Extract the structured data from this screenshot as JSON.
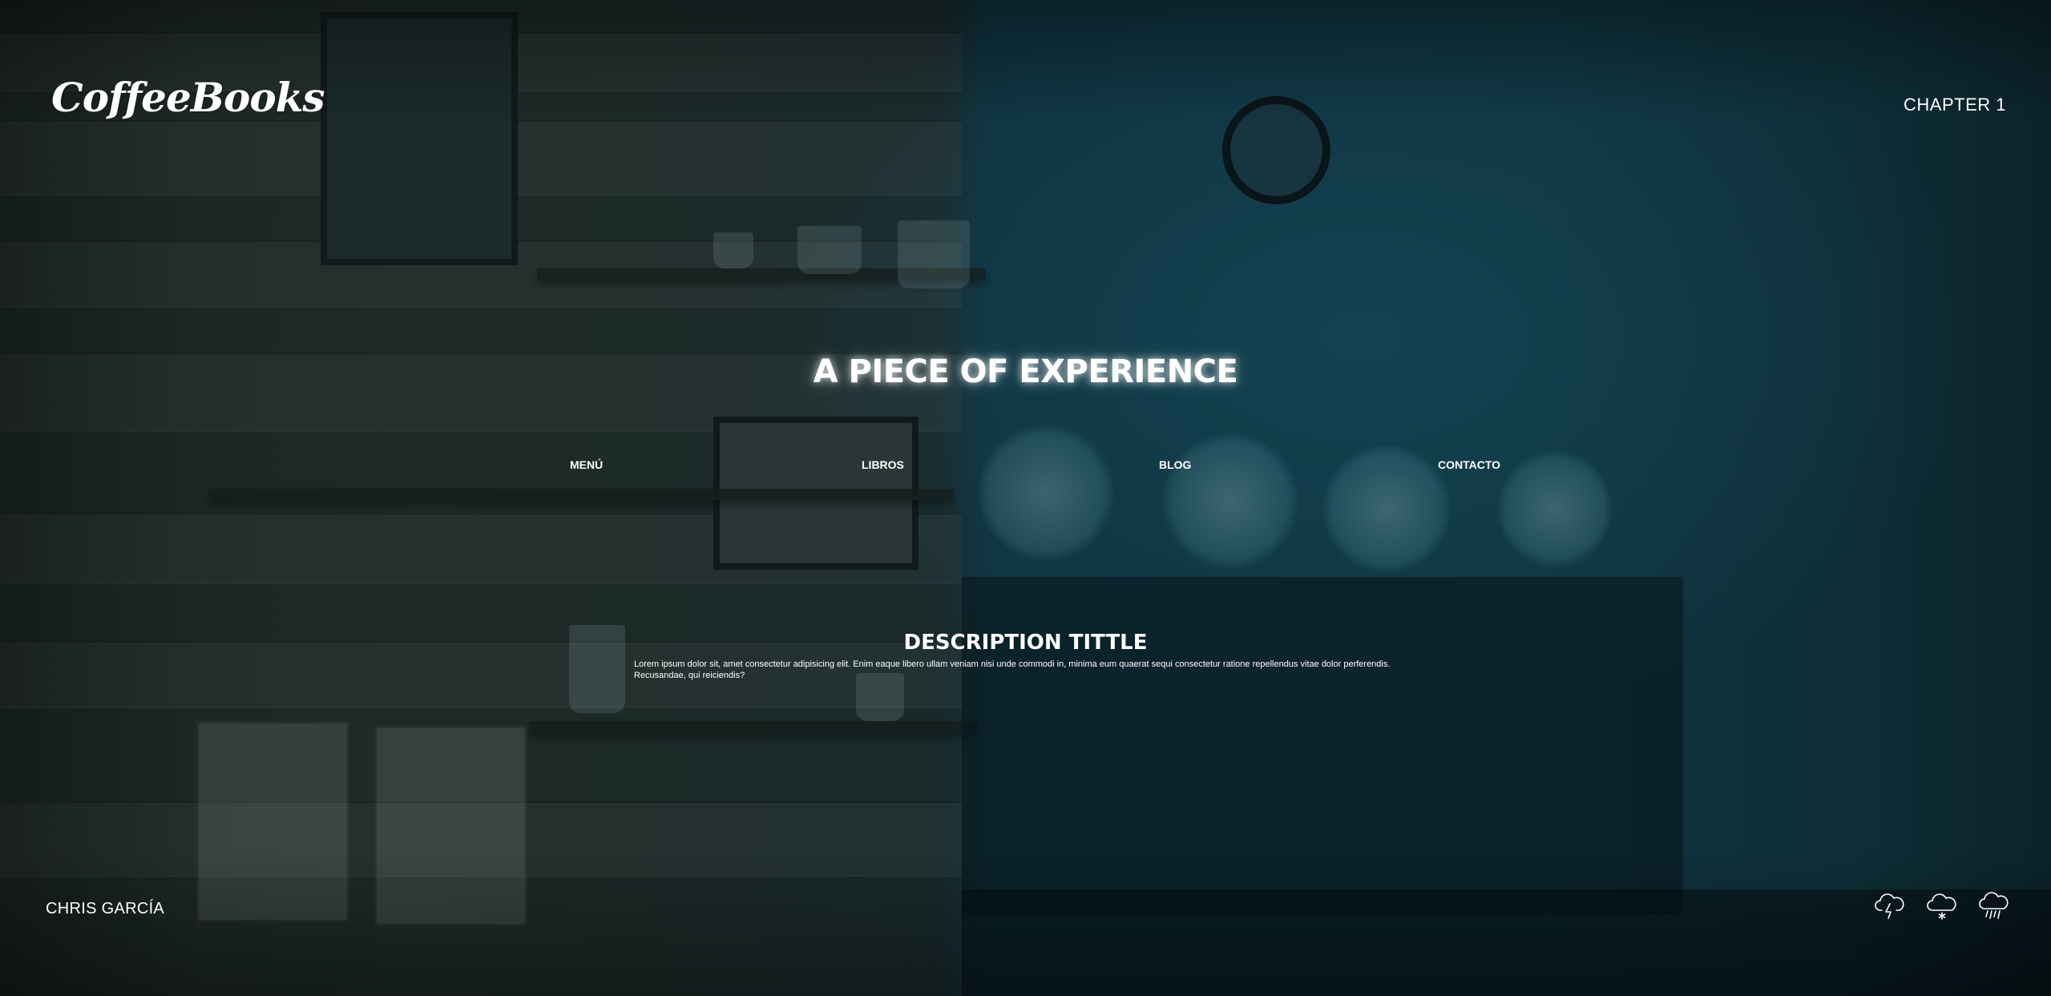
{
  "header": {
    "logo": "CoffeeBooks",
    "chapter_label": "CHAPTER 1"
  },
  "hero": {
    "title": "A PIECE OF EXPERIENCE"
  },
  "nav": {
    "items": [
      {
        "label": "MENÚ"
      },
      {
        "label": "LIBROS"
      },
      {
        "label": "BLOG"
      },
      {
        "label": "CONTACTO"
      }
    ]
  },
  "description": {
    "title": "DESCRIPTION TITTLE",
    "line1": "Lorem ipsum dolor sit, amet consectetur adipisicing elit. Enim eaque libero ullam veniam nisi unde commodi in, minima eum quaerat sequi consectetur ratione repellendus vitae dolor perferendis.",
    "line2": "Recusandae, qui reiciendis?"
  },
  "footer": {
    "author": "CHRIS GARCÍA",
    "weather_icons": [
      "cloud-lightning-icon",
      "cloud-snow-icon",
      "cloud-rain-icon"
    ]
  }
}
